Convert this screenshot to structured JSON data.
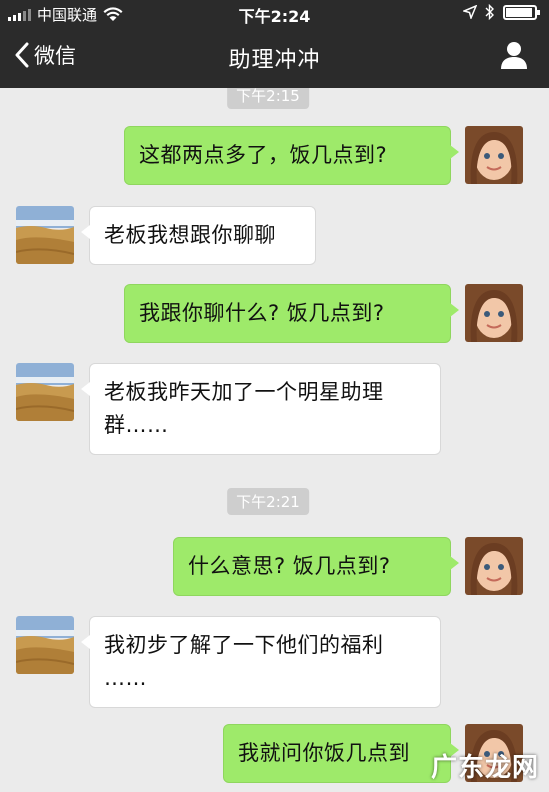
{
  "status_bar": {
    "carrier": "中国联通",
    "time": "下午2:24",
    "battery_level": 0.85
  },
  "nav": {
    "back_label": "微信",
    "title": "助理冲冲"
  },
  "timestamps": [
    "下午2:15",
    "下午2:21"
  ],
  "messages": [
    {
      "side": "right",
      "text": "这都两点多了，饭几点到?"
    },
    {
      "side": "left",
      "text": "老板我想跟你聊聊"
    },
    {
      "side": "right",
      "text": "我跟你聊什么? 饭几点到?"
    },
    {
      "side": "left",
      "line1": "老板我昨天加了一个明星助理",
      "line2": "群……"
    },
    {
      "side": "right",
      "text": "什么意思? 饭几点到?"
    },
    {
      "side": "left",
      "line1": "我初步了解了一下他们的福利",
      "line2": "……"
    },
    {
      "side": "right",
      "text": "我就问你饭几点到"
    }
  ],
  "watermark": "广东龙网",
  "icons": {
    "back": "chevron-left-icon",
    "profile": "person-icon",
    "wifi": "wifi-icon",
    "location": "location-arrow-icon",
    "bluetooth": "bluetooth-icon"
  },
  "colors": {
    "nav_bg": "#2b2b2b",
    "chat_bg": "#ebebeb",
    "bubble_self": "#9eea6a",
    "bubble_other": "#ffffff"
  }
}
